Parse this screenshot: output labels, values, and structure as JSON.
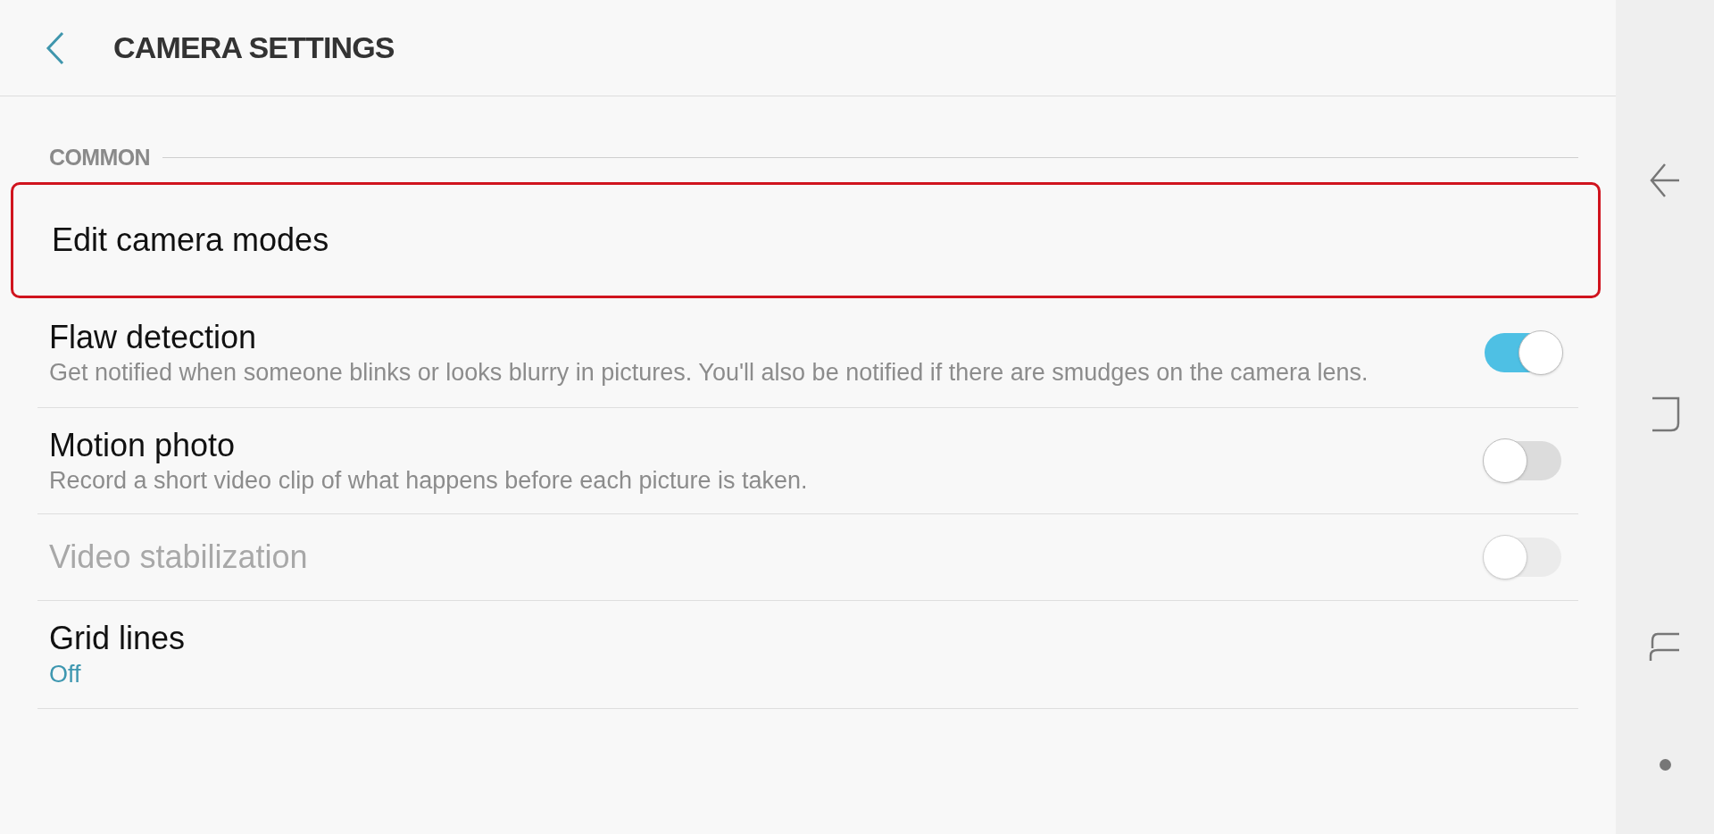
{
  "header": {
    "title": "CAMERA SETTINGS"
  },
  "section": {
    "label": "COMMON"
  },
  "items": [
    {
      "kind": "link",
      "title": "Edit camera modes",
      "highlighted": true,
      "disabled": false
    },
    {
      "kind": "toggle",
      "title": "Flaw detection",
      "subtitle": "Get notified when someone blinks or looks blurry in pictures. You'll also be notified if there are smudges on the camera lens.",
      "on": true,
      "disabled": false,
      "highlighted": false
    },
    {
      "kind": "toggle",
      "title": "Motion photo",
      "subtitle": "Record a short video clip of what happens before each picture is taken.",
      "on": false,
      "disabled": false,
      "highlighted": false
    },
    {
      "kind": "toggle",
      "title": "Video stabilization",
      "on": false,
      "disabled": true,
      "highlighted": false
    },
    {
      "kind": "value",
      "title": "Grid lines",
      "value": "Off",
      "disabled": false,
      "highlighted": false
    }
  ]
}
